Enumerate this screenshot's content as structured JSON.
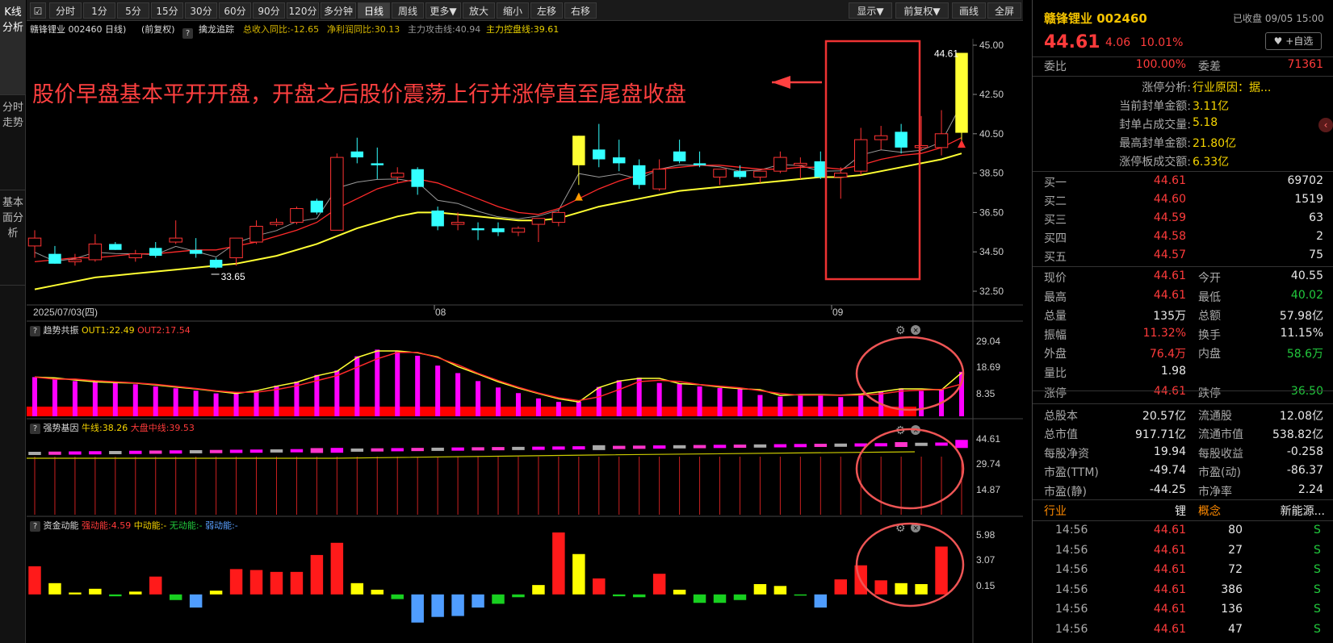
{
  "sidebar": {
    "tabs": [
      "K线分析",
      "分时走势",
      "基本面分析"
    ]
  },
  "toolbar": {
    "left": [
      "分时",
      "1分",
      "5分",
      "15分",
      "30分",
      "60分",
      "90分",
      "120分",
      "多分钟",
      "日线",
      "周线",
      "更多▼",
      "放大",
      "缩小",
      "左移",
      "右移"
    ],
    "active": "日线",
    "right": [
      "显示▼",
      "前复权▼",
      "画线",
      "全屏"
    ]
  },
  "infobar": {
    "stock": "赣锋锂业 002460 日线)",
    "adj": "(前复权)",
    "indicator": "擒龙追踪",
    "metric1": "总收入同比:-12.65",
    "metric2": "净利润同比:30.13",
    "metric3": "主力攻击线:40.94",
    "metric4": "主力控盘线:39.61"
  },
  "annotation": "股价早盘基本平开开盘，开盘之后股价震荡上行并涨停直至尾盘收盘",
  "main_chart": {
    "price_axis": [
      "45.00",
      "42.50",
      "40.50",
      "38.50",
      "36.50",
      "34.50",
      "32.50"
    ],
    "date_labels": [
      "2025/07/03(四)",
      "08",
      "09"
    ],
    "high_label": "44.61",
    "low_label": "33.65"
  },
  "sub1": {
    "name": "趋势共振",
    "out1": "OUT1:22.49",
    "out2": "OUT2:17.54",
    "axis": [
      "29.04",
      "18.69",
      "8.35"
    ]
  },
  "sub2": {
    "name": "强势基因",
    "l1": "牛线:38.26",
    "l2": "大盘中线:39.53",
    "axis": [
      "44.61",
      "29.74",
      "14.87"
    ]
  },
  "sub3": {
    "name": "资金动能",
    "s": "强动能:4.59",
    "m": "中动能:-",
    "n": "无动能:-",
    "w": "弱动能:-",
    "axis": [
      "5.98",
      "3.07",
      "0.15"
    ]
  },
  "right": {
    "name": "赣锋锂业 002460",
    "status": "已收盘 09/05 15:00",
    "price": "44.61",
    "chg": "4.06",
    "pct": "10.01%",
    "fav": "+自选",
    "weibi_label": "委比",
    "weibi": "100.00%",
    "weicha_label": "委差",
    "weicha": "71361",
    "limit": [
      {
        "k": "涨停分析:",
        "v": "行业原因：据..."
      },
      {
        "k": "当前封单金额:",
        "v": "3.11亿"
      },
      {
        "k": "封单占成交量:",
        "v": "5.18"
      },
      {
        "k": "最高封单金额:",
        "v": "21.80亿"
      },
      {
        "k": "涨停板成交额:",
        "v": "6.33亿"
      }
    ],
    "bids": [
      {
        "k": "买一",
        "p": "44.61",
        "v": "69702"
      },
      {
        "k": "买二",
        "p": "44.60",
        "v": "1519"
      },
      {
        "k": "买三",
        "p": "44.59",
        "v": "63"
      },
      {
        "k": "买四",
        "p": "44.58",
        "v": "2"
      },
      {
        "k": "买五",
        "p": "44.57",
        "v": "75"
      }
    ],
    "stats": [
      {
        "k1": "现价",
        "v1": "44.61",
        "c1": "red",
        "k2": "今开",
        "v2": "40.55",
        "c2": "wht"
      },
      {
        "k1": "最高",
        "v1": "44.61",
        "c1": "red",
        "k2": "最低",
        "v2": "40.02",
        "c2": "green"
      },
      {
        "k1": "总量",
        "v1": "135万",
        "c1": "wht",
        "k2": "总额",
        "v2": "57.98亿",
        "c2": "wht"
      },
      {
        "k1": "振幅",
        "v1": "11.32%",
        "c1": "red",
        "k2": "换手",
        "v2": "11.15%",
        "c2": "wht"
      },
      {
        "k1": "外盘",
        "v1": "76.4万",
        "c1": "red",
        "k2": "内盘",
        "v2": "58.6万",
        "c2": "green"
      },
      {
        "k1": "量比",
        "v1": "1.98",
        "c1": "wht",
        "k2": "",
        "v2": "",
        "c2": "wht"
      },
      {
        "k1": "涨停",
        "v1": "44.61",
        "c1": "red",
        "k2": "跌停",
        "v2": "36.50",
        "c2": "green"
      },
      {
        "k1": "总股本",
        "v1": "20.57亿",
        "c1": "wht",
        "k2": "流通股",
        "v2": "12.08亿",
        "c2": "wht"
      },
      {
        "k1": "总市值",
        "v1": "917.71亿",
        "c1": "wht",
        "k2": "流通市值",
        "v2": "538.82亿",
        "c2": "wht"
      },
      {
        "k1": "每股净资",
        "v1": "19.94",
        "c1": "wht",
        "k2": "每股收益",
        "v2": "-0.258",
        "c2": "wht"
      },
      {
        "k1": "市盈(TTM)",
        "v1": "-49.74",
        "c1": "wht",
        "k2": "市盈(动)",
        "v2": "-86.37",
        "c2": "wht"
      },
      {
        "k1": "市盈(静)",
        "v1": "-44.25",
        "c1": "wht",
        "k2": "市净率",
        "v2": "2.24",
        "c2": "wht"
      }
    ],
    "industry": {
      "k1": "行业",
      "v1": "锂",
      "k2": "概念",
      "v2": "新能源..."
    },
    "trades": [
      {
        "t": "14:56",
        "p": "44.61",
        "v": "80",
        "s": "S"
      },
      {
        "t": "14:56",
        "p": "44.61",
        "v": "27",
        "s": "S"
      },
      {
        "t": "14:56",
        "p": "44.61",
        "v": "72",
        "s": "S"
      },
      {
        "t": "14:56",
        "p": "44.61",
        "v": "386",
        "s": "S"
      },
      {
        "t": "14:56",
        "p": "44.61",
        "v": "136",
        "s": "S"
      },
      {
        "t": "14:56",
        "p": "44.61",
        "v": "47",
        "s": "S"
      }
    ]
  },
  "chart_data": {
    "type": "candlestick",
    "ylim": [
      32.5,
      45.0
    ],
    "candles": [
      {
        "o": 34.8,
        "h": 35.6,
        "l": 34.2,
        "c": 35.2
      },
      {
        "o": 34.4,
        "h": 34.8,
        "l": 33.9,
        "c": 33.9
      },
      {
        "o": 34.0,
        "h": 34.4,
        "l": 33.8,
        "c": 34.1
      },
      {
        "o": 34.1,
        "h": 35.4,
        "l": 34.0,
        "c": 34.9
      },
      {
        "o": 34.9,
        "h": 35.0,
        "l": 34.6,
        "c": 34.6
      },
      {
        "o": 34.2,
        "h": 34.6,
        "l": 34.0,
        "c": 34.4
      },
      {
        "o": 34.7,
        "h": 35.0,
        "l": 34.2,
        "c": 34.3
      },
      {
        "o": 35.0,
        "h": 36.1,
        "l": 34.9,
        "c": 35.2
      },
      {
        "o": 34.6,
        "h": 35.2,
        "l": 34.2,
        "c": 34.4
      },
      {
        "o": 34.1,
        "h": 34.2,
        "l": 33.65,
        "c": 33.7
      },
      {
        "o": 34.2,
        "h": 35.2,
        "l": 33.8,
        "c": 35.2
      },
      {
        "o": 35.0,
        "h": 36.1,
        "l": 34.9,
        "c": 35.8
      },
      {
        "o": 35.9,
        "h": 36.2,
        "l": 35.8,
        "c": 36.0
      },
      {
        "o": 36.0,
        "h": 36.8,
        "l": 35.9,
        "c": 36.7
      },
      {
        "o": 37.1,
        "h": 37.2,
        "l": 36.4,
        "c": 36.5
      },
      {
        "o": 35.6,
        "h": 39.5,
        "l": 35.6,
        "c": 39.3
      },
      {
        "o": 39.6,
        "h": 40.3,
        "l": 39.0,
        "c": 39.3
      },
      {
        "o": 39.0,
        "h": 39.8,
        "l": 38.2,
        "c": 38.9
      },
      {
        "o": 38.3,
        "h": 38.8,
        "l": 38.0,
        "c": 38.5
      },
      {
        "o": 38.7,
        "h": 38.8,
        "l": 37.4,
        "c": 37.8
      },
      {
        "o": 36.6,
        "h": 36.8,
        "l": 35.6,
        "c": 35.8
      },
      {
        "o": 35.9,
        "h": 36.5,
        "l": 35.6,
        "c": 36.0
      },
      {
        "o": 35.7,
        "h": 36.0,
        "l": 35.1,
        "c": 35.6
      },
      {
        "o": 35.7,
        "h": 36.0,
        "l": 35.3,
        "c": 35.5
      },
      {
        "o": 35.5,
        "h": 35.8,
        "l": 35.3,
        "c": 35.7
      },
      {
        "o": 35.9,
        "h": 36.2,
        "l": 35.0,
        "c": 36.2
      },
      {
        "o": 36.0,
        "h": 36.6,
        "l": 35.8,
        "c": 36.5
      },
      {
        "o": 38.9,
        "h": 40.4,
        "l": 37.9,
        "c": 40.4
      },
      {
        "o": 39.7,
        "h": 41.0,
        "l": 38.8,
        "c": 39.2
      },
      {
        "o": 39.3,
        "h": 40.2,
        "l": 38.6,
        "c": 39.0
      },
      {
        "o": 38.9,
        "h": 39.2,
        "l": 37.7,
        "c": 37.9
      },
      {
        "o": 37.7,
        "h": 39.2,
        "l": 37.6,
        "c": 38.7
      },
      {
        "o": 39.6,
        "h": 40.2,
        "l": 39.0,
        "c": 39.1
      },
      {
        "o": 39.0,
        "h": 39.6,
        "l": 38.8,
        "c": 38.9
      },
      {
        "o": 38.3,
        "h": 38.7,
        "l": 37.9,
        "c": 38.7
      },
      {
        "o": 38.6,
        "h": 38.9,
        "l": 38.2,
        "c": 38.3
      },
      {
        "o": 38.3,
        "h": 38.6,
        "l": 38.0,
        "c": 38.6
      },
      {
        "o": 38.6,
        "h": 39.6,
        "l": 38.5,
        "c": 39.3
      },
      {
        "o": 38.9,
        "h": 39.3,
        "l": 38.2,
        "c": 39.0
      },
      {
        "o": 39.1,
        "h": 39.6,
        "l": 38.2,
        "c": 38.3
      },
      {
        "o": 38.3,
        "h": 38.8,
        "l": 37.2,
        "c": 38.5
      },
      {
        "o": 38.6,
        "h": 40.8,
        "l": 38.4,
        "c": 40.2
      },
      {
        "o": 40.2,
        "h": 40.9,
        "l": 39.7,
        "c": 40.4
      },
      {
        "o": 40.6,
        "h": 41.0,
        "l": 39.5,
        "c": 39.8
      },
      {
        "o": 39.8,
        "h": 41.4,
        "l": 39.7,
        "c": 39.9
      },
      {
        "o": 39.8,
        "h": 41.7,
        "l": 39.4,
        "c": 40.5
      },
      {
        "o": 40.55,
        "h": 44.61,
        "l": 40.02,
        "c": 44.61
      }
    ],
    "ma_red": [
      34.0,
      34.1,
      34.2,
      34.2,
      34.3,
      34.4,
      34.4,
      34.5,
      34.6,
      34.6,
      34.8,
      35.0,
      35.3,
      35.6,
      36.0,
      36.7,
      37.2,
      37.7,
      38.0,
      38.2,
      38.0,
      37.6,
      37.2,
      36.8,
      36.5,
      36.4,
      36.7,
      37.2,
      37.7,
      38.1,
      38.4,
      38.7,
      38.8,
      38.9,
      38.9,
      38.8,
      38.7,
      38.7,
      38.8,
      38.8,
      38.7,
      38.9,
      39.2,
      39.4,
      39.5,
      39.8,
      40.3
    ],
    "ma_yellow": [
      32.6,
      32.8,
      33.0,
      33.2,
      33.3,
      33.4,
      33.5,
      33.6,
      33.7,
      33.8,
      33.9,
      34.1,
      34.3,
      34.6,
      34.9,
      35.3,
      35.7,
      36.0,
      36.3,
      36.5,
      36.5,
      36.4,
      36.3,
      36.2,
      36.1,
      36.1,
      36.2,
      36.5,
      36.8,
      37.0,
      37.2,
      37.4,
      37.6,
      37.7,
      37.8,
      37.9,
      38.0,
      38.1,
      38.2,
      38.3,
      38.3,
      38.4,
      38.6,
      38.8,
      39.0,
      39.2,
      39.5
    ],
    "sub1_values": [
      14.7,
      13.9,
      13.2,
      12.9,
      12.7,
      12.0,
      11.2,
      10.5,
      9.6,
      8.6,
      8.7,
      9.8,
      11.5,
      13.0,
      15.5,
      17.2,
      22.5,
      25.0,
      24.3,
      22.7,
      19.0,
      16.2,
      13.2,
      10.8,
      8.7,
      6.7,
      5.4,
      5.5,
      11.0,
      13.5,
      14.5,
      12.5,
      12.1,
      11.2,
      10.6,
      10.2,
      8.0,
      7.4,
      8.3,
      8.1,
      7.2,
      8.5,
      9.4,
      10.5,
      9.5,
      10.1,
      16.7
    ],
    "sub1_ylim": [
      0,
      29.04
    ],
    "sub3_values": [
      3.0,
      1.2,
      0.2,
      0.6,
      -0.2,
      0.3,
      1.9,
      -0.6,
      -1.4,
      0.4,
      2.7,
      2.6,
      2.4,
      2.4,
      4.2,
      5.5,
      1.2,
      0.5,
      -0.5,
      -3.0,
      -2.4,
      -2.3,
      -1.4,
      -1.0,
      -0.3,
      1.0,
      6.6,
      4.3,
      1.7,
      -0.2,
      -0.3,
      2.2,
      0.5,
      -0.9,
      -0.9,
      -0.6,
      1.1,
      0.9,
      -0.1,
      -1.4,
      1.6,
      3.1,
      1.5,
      1.2,
      1.1,
      5.1
    ],
    "sub3_ylim": [
      -3.2,
      6.6
    ]
  }
}
